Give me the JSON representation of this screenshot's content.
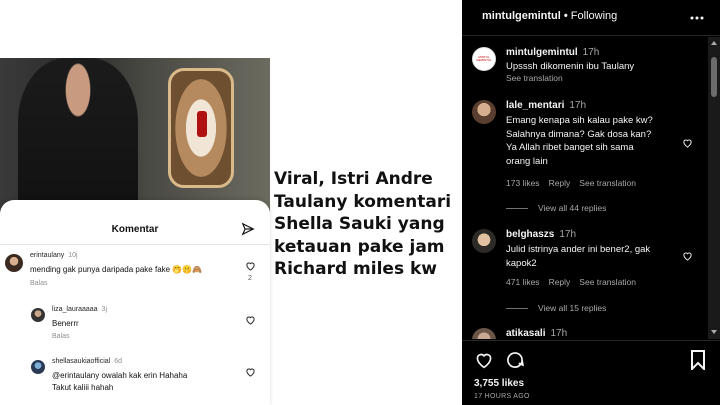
{
  "headline": {
    "lines": [
      "Viral, Istri Andre",
      "Taulany komentari",
      "Shella Sauki yang",
      "ketauan pake jam",
      "Richard miles kw"
    ]
  },
  "screenshot_comments": {
    "title": "Komentar",
    "items": [
      {
        "user": "erintaulany",
        "time": "10j",
        "text": "mending gak punya daripada pake fake 🤭🤫🙈",
        "reply": "Balas",
        "likes": "2"
      },
      {
        "user": "liza_lauraaaaa",
        "time": "3j",
        "text": "Benerrr",
        "reply": "Balas"
      },
      {
        "user": "shellasaukiaofficial",
        "time": "6d",
        "text_line1": "@erintaulany owalah kak erin Hahaha",
        "text_line2": "Takut kaliii hahah"
      }
    ]
  },
  "instagram": {
    "header": {
      "username": "mintulgemintul",
      "separator": " • ",
      "follow_status": "Following"
    },
    "caption": {
      "username": "mintulgemintul",
      "ago": "17h",
      "text": "Upsssh dikomenin ibu Taulany",
      "translation": "See translation",
      "avatar_text": "MINTUL GEMINTUL"
    },
    "comments": [
      {
        "username": "lale_mentari",
        "ago": "17h",
        "lines": [
          "Emang kenapa sih kalau pake kw?",
          "Salahnya dimana? Gak dosa kan?",
          "Ya Allah ribet banget sih sama",
          "orang lain"
        ],
        "likes": "173 likes",
        "reply": "Reply",
        "translation": "See translation",
        "view_replies": "View all 44 replies"
      },
      {
        "username": "belghaszs",
        "ago": "17h",
        "lines": [
          "Julid istrinya ander ini bener2, gak",
          "kapok2"
        ],
        "likes": "471 likes",
        "reply": "Reply",
        "translation": "See translation",
        "view_replies": "View all 15 replies"
      },
      {
        "username": "atikasali",
        "ago": "17h"
      }
    ],
    "likes_count": "3,755 likes",
    "posted": "17 HOURS AGO",
    "icons": [
      "heart-icon",
      "comment-icon",
      "bookmark-icon",
      "more-icon"
    ]
  },
  "colors": {
    "ig_bg": "#000000",
    "ig_text": "#f5f5f5",
    "ig_secondary": "#a8a8a8"
  }
}
